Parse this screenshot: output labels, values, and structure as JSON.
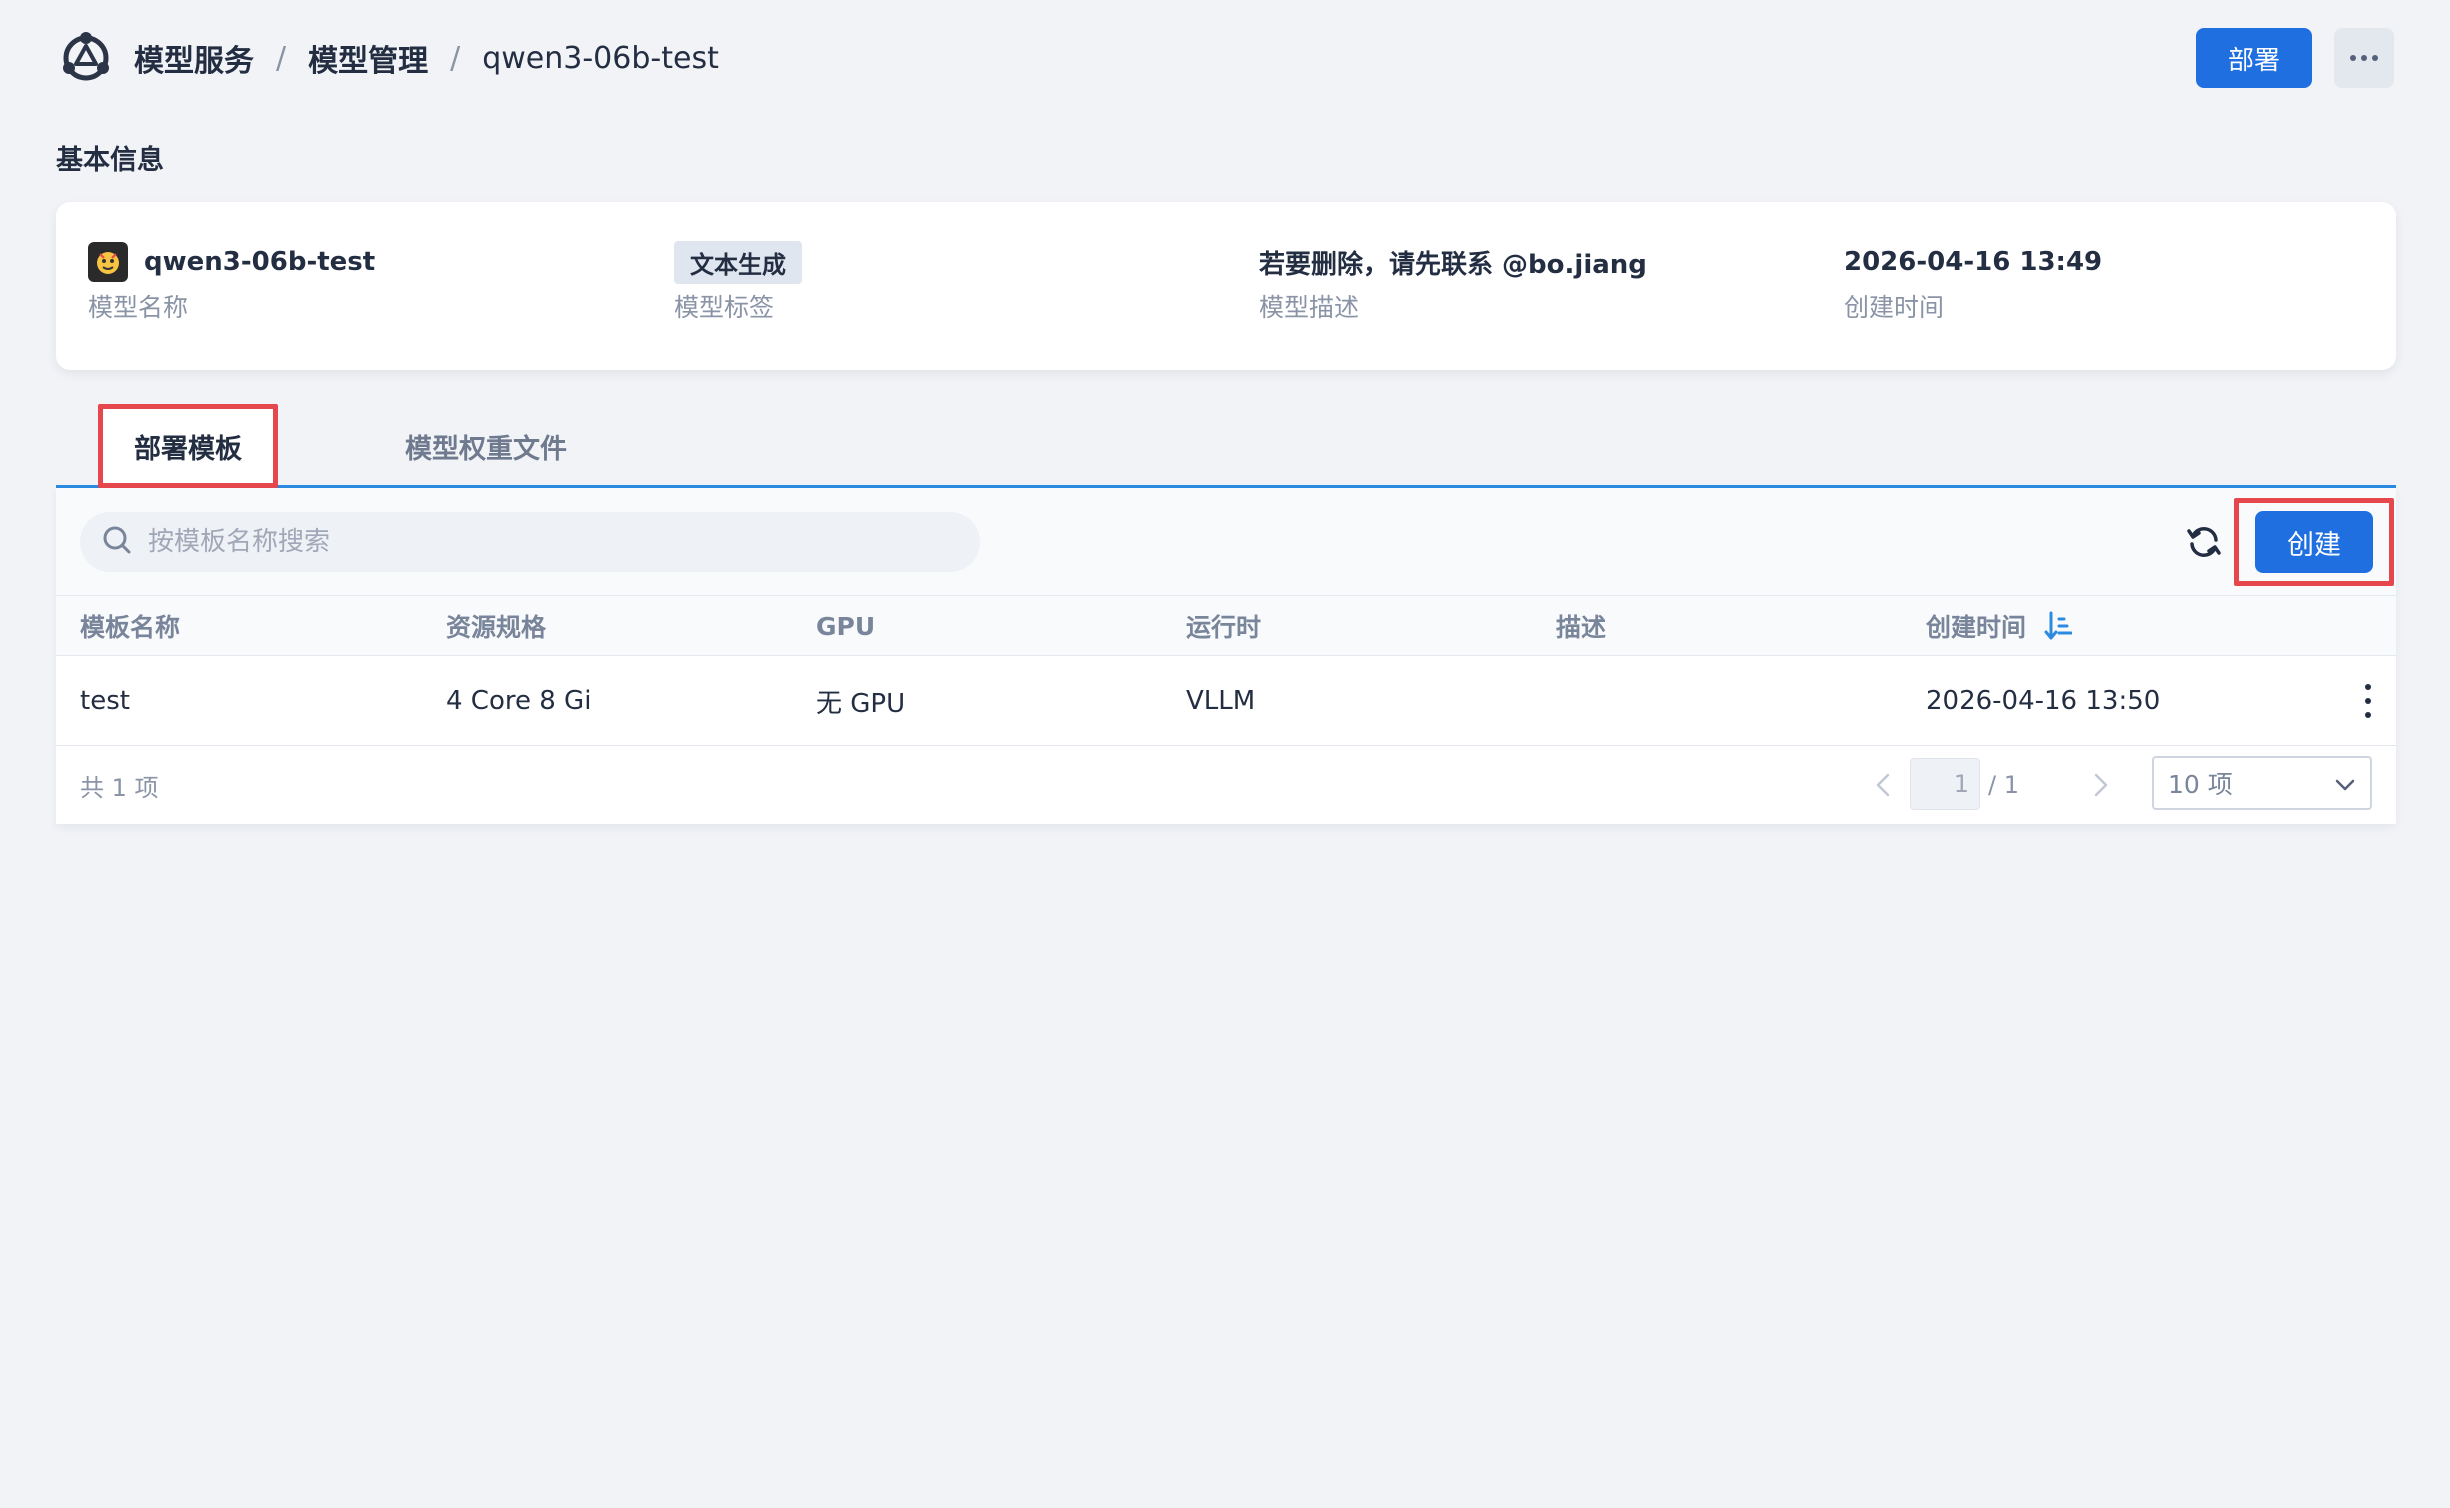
{
  "header": {
    "breadcrumb": [
      "模型服务",
      "模型管理",
      "qwen3-06b-test"
    ],
    "separator": "/",
    "deploy_label": "部署"
  },
  "basic_info": {
    "title": "基本信息",
    "model_name": {
      "value": "qwen3-06b-test",
      "label": "模型名称"
    },
    "model_tag": {
      "value": "文本生成",
      "label": "模型标签"
    },
    "model_desc": {
      "value": "若要删除，请先联系 @bo.jiang",
      "label": "模型描述"
    },
    "created": {
      "value": "2026-04-16 13:49",
      "label": "创建时间"
    }
  },
  "tabs": [
    {
      "label": "部署模板",
      "active": true
    },
    {
      "label": "模型权重文件",
      "active": false
    }
  ],
  "toolbar": {
    "search_placeholder": "按模板名称搜索",
    "create_label": "创建"
  },
  "table": {
    "columns": [
      "模板名称",
      "资源规格",
      "GPU",
      "运行时",
      "描述",
      "创建时间"
    ],
    "rows": [
      {
        "name": "test",
        "spec": "4 Core 8 Gi",
        "gpu": "无 GPU",
        "runtime": "VLLM",
        "desc": "",
        "created": "2026-04-16 13:50"
      }
    ]
  },
  "pagination": {
    "total": "共 1 项",
    "current_page": "1",
    "page_total": "/ 1",
    "page_size": "10 项"
  },
  "colors": {
    "primary": "#1f6fe0",
    "highlight": "#e5474d",
    "tab_underline": "#2b8be0"
  }
}
